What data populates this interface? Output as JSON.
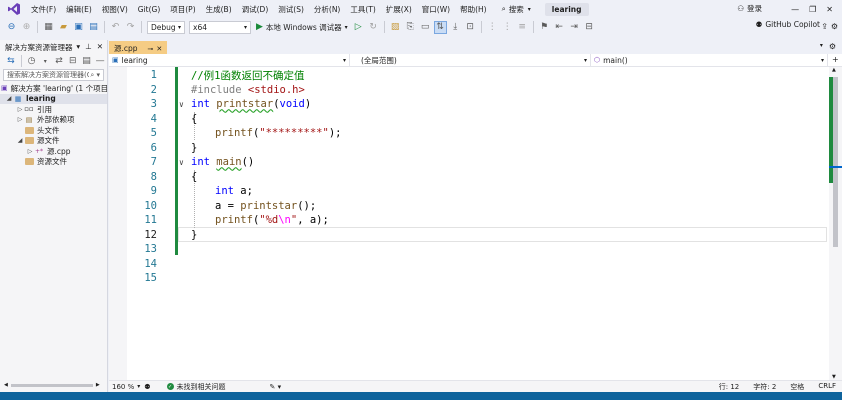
{
  "menubar": {
    "items": [
      "文件(F)",
      "编辑(E)",
      "视图(V)",
      "Git(G)",
      "项目(P)",
      "生成(B)",
      "调试(D)",
      "测试(S)",
      "分析(N)",
      "工具(T)",
      "扩展(X)",
      "窗口(W)",
      "帮助(H)"
    ],
    "search_label": "搜索",
    "solution_name": "learing",
    "login_label": "登录"
  },
  "toolbar": {
    "config": "Debug",
    "platform": "x64",
    "run_label": "本地 Windows 调试器",
    "copilot_label": "GitHub Copilot"
  },
  "solution_explorer": {
    "title": "解决方案资源管理器",
    "search_placeholder": "搜索解决方案资源管理器(Ctrl+;)",
    "tree": [
      {
        "label": "解决方案 'learing' (1 个项目",
        "indent": 0,
        "icon": "solution-icon"
      },
      {
        "label": "learing",
        "indent": 1,
        "icon": "project-icon",
        "bold": true,
        "selected": true
      },
      {
        "label": "引用",
        "indent": 2,
        "icon": "references-icon"
      },
      {
        "label": "外部依赖项",
        "indent": 2,
        "icon": "external-deps-icon"
      },
      {
        "label": "头文件",
        "indent": 2,
        "icon": "folder-icon"
      },
      {
        "label": "源文件",
        "indent": 2,
        "icon": "folder-icon"
      },
      {
        "label": "源.cpp",
        "indent": 3,
        "icon": "cpp-file-icon"
      },
      {
        "label": "资源文件",
        "indent": 2,
        "icon": "folder-icon"
      }
    ]
  },
  "editor": {
    "tab_label": "源.cpp",
    "nav_project": "learing",
    "nav_scope": "(全局范围)",
    "nav_member": "main()",
    "current_line": 12,
    "line_numbers": [
      "1",
      "2",
      "3",
      "4",
      "5",
      "6",
      "7",
      "8",
      "9",
      "10",
      "11",
      "12",
      "13",
      "14",
      "15"
    ]
  },
  "code": {
    "l1": "//例1函数返回不确定值",
    "l2_pre": "#include ",
    "l2_hdr": "<stdio.h>",
    "l3_kw": "int",
    "l3_fn": "printstar",
    "l3_paren_open": "(",
    "l3_void": "void",
    "l3_paren_close": ")",
    "l4": "{",
    "l5_fn": "printf",
    "l5_open": "(",
    "l5_str": "\"*********\"",
    "l5_close": ");",
    "l6": "}",
    "l7_kw": "int",
    "l7_fn": "main",
    "l7_rest": "()",
    "l8": "{",
    "l9_kw": "int",
    "l9_rest": " a;",
    "l10_a": "a = ",
    "l10_fn": "printstar",
    "l10_rest": "();",
    "l11_fn": "printf",
    "l11_open": "(",
    "l11_str1": "\"%d",
    "l11_esc": "\\n",
    "l11_str2": "\"",
    "l11_rest": ", a);",
    "l12": "}"
  },
  "status": {
    "zoom": "160 %",
    "issues": "未找到相关问题",
    "line": "行: 12",
    "char": "字符: 2",
    "spacing": "空格",
    "eol": "CRLF"
  }
}
